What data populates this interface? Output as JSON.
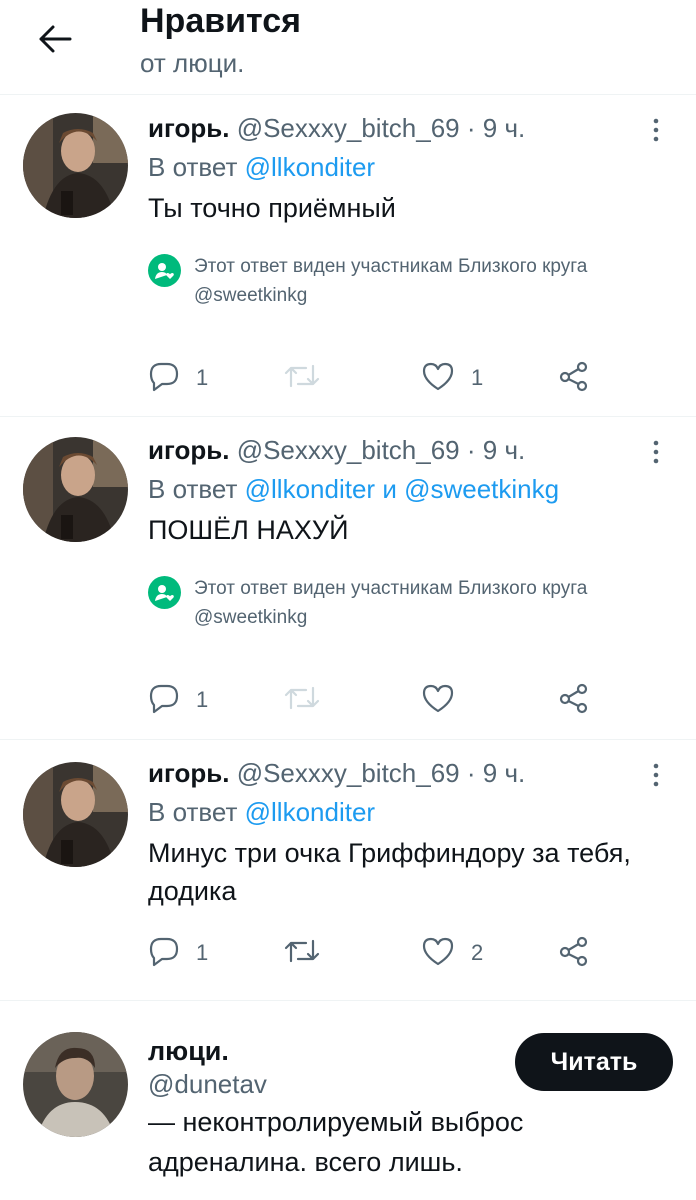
{
  "header": {
    "title": "Нравится",
    "subtitle": "от люци."
  },
  "tweets": [
    {
      "name": "игорь.",
      "handle": "@Sexxxy_bitch_69",
      "separator": "·",
      "time": "9 ч.",
      "reply_prefix": "В ответ",
      "mention1": "@llkonditer",
      "reply_joiner": "",
      "mention2": "",
      "text": "Ты точно приёмный",
      "circle_note_line1": "Этот ответ виден участникам Близкого круга",
      "circle_note_line2": "@sweetkinkg",
      "reply_count": "1",
      "retweet_count": "",
      "like_count": "1"
    },
    {
      "name": "игорь.",
      "handle": "@Sexxxy_bitch_69",
      "separator": "·",
      "time": "9 ч.",
      "reply_prefix": "В ответ",
      "mention1": "@llkonditer",
      "reply_joiner": "и",
      "mention2": "@sweetkinkg",
      "text": "ПОШЁЛ НАХУЙ",
      "circle_note_line1": "Этот ответ виден участникам Близкого круга",
      "circle_note_line2": "@sweetkinkg",
      "reply_count": "1",
      "retweet_count": "",
      "like_count": ""
    },
    {
      "name": "игорь.",
      "handle": "@Sexxxy_bitch_69",
      "separator": "·",
      "time": "9 ч.",
      "reply_prefix": "В ответ",
      "mention1": "@llkonditer",
      "reply_joiner": "",
      "mention2": "",
      "text": "Минус три очка Гриффиндору за тебя, додика",
      "reply_count": "1",
      "retweet_count": "",
      "like_count": "2"
    }
  ],
  "profile": {
    "name": "люци.",
    "handle": "@dunetav",
    "bio": "— неконтролируемый выброс адреналина. всего лишь.",
    "follow_label": "Читать"
  },
  "icons": {
    "back": "arrow-left-icon",
    "more": "more-vertical-icon",
    "reply": "reply-icon",
    "retweet": "retweet-icon",
    "like": "heart-icon",
    "share": "share-icon",
    "circle": "close-circle-icon"
  },
  "colors": {
    "text": "#0f1419",
    "secondary": "#536471",
    "link": "#1d9bf0",
    "circle_green": "#00ba7c",
    "button_bg": "#0f1419"
  }
}
